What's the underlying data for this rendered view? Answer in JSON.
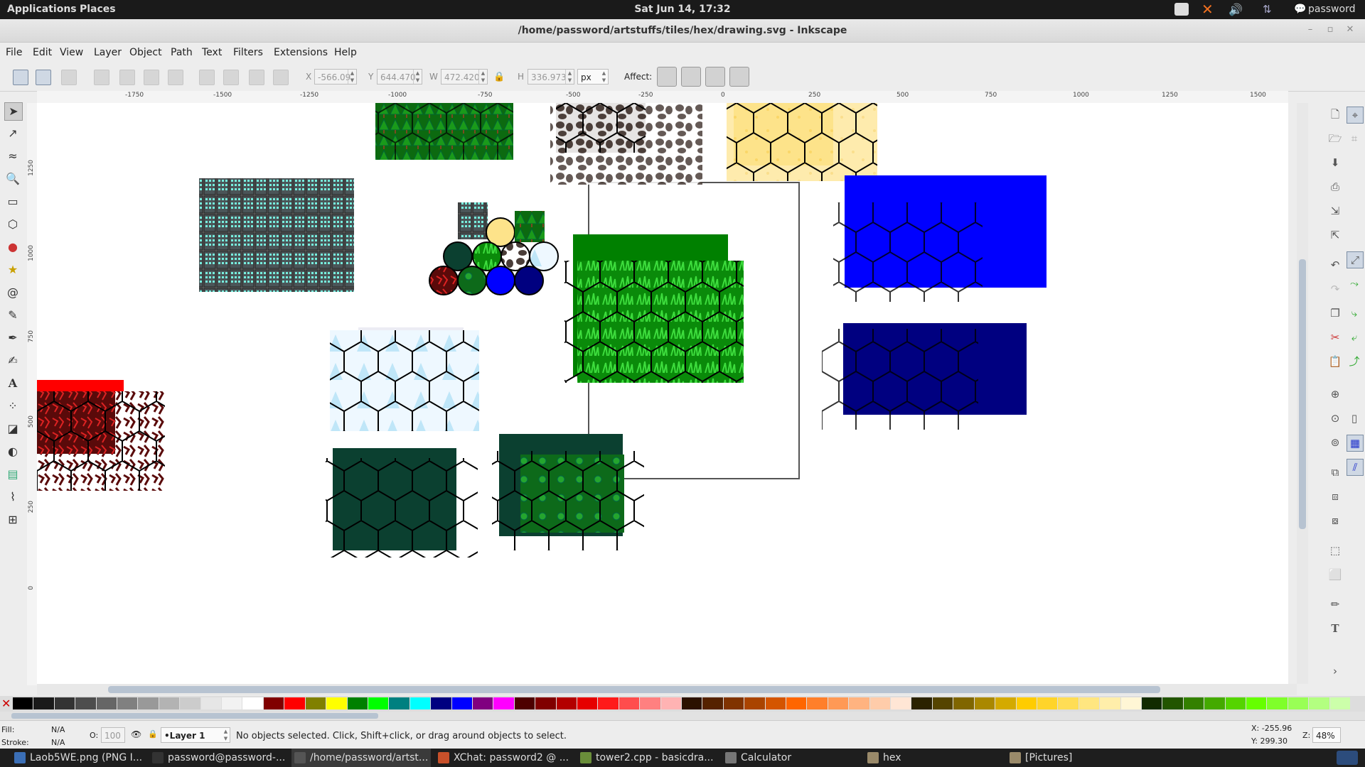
{
  "top_panel": {
    "applications": "Applications",
    "places": "Places",
    "clock": "Sat Jun 14, 17:32",
    "user": "password"
  },
  "window": {
    "title": "/home/password/artstuffs/tiles/hex/drawing.svg - Inkscape"
  },
  "menubar": {
    "items": [
      "File",
      "Edit",
      "View",
      "Layer",
      "Object",
      "Path",
      "Text",
      "Filters",
      "Extensions",
      "Help"
    ]
  },
  "toolbar": {
    "x_label": "X",
    "x_value": "-566.09",
    "y_label": "Y",
    "y_value": "644.470",
    "w_label": "W",
    "w_value": "472.420",
    "h_label": "H",
    "h_value": "336.973",
    "unit": "px",
    "affect_label": "Affect:"
  },
  "ruler": {
    "h_ticks": [
      "-1750",
      "-1500",
      "-1250",
      "-1000",
      "-750",
      "-500",
      "-250",
      "0",
      "250",
      "500",
      "750",
      "1000",
      "1250",
      "1500"
    ],
    "v_ticks": [
      "1250",
      "1000",
      "750",
      "500",
      "250",
      "0"
    ]
  },
  "status": {
    "fill_label": "Fill:",
    "fill_value": "N/A",
    "stroke_label": "Stroke:",
    "stroke_value": "N/A",
    "opacity_label": "O:",
    "opacity_value": "100",
    "layer": "•Layer 1",
    "message": "No objects selected. Click, Shift+click, or drag around objects to select.",
    "x_coord": "X: -255.96",
    "y_coord": "Y: 299.30",
    "zoom_label": "Z:",
    "zoom_value": "48%"
  },
  "taskbar": [
    {
      "label": "Laob5WE.png (PNG I...",
      "color": "#3b6fb6"
    },
    {
      "label": "password@password-...",
      "color": "#333333"
    },
    {
      "label": "/home/password/artst...",
      "color": "#555555"
    },
    {
      "label": "XChat: password2 @ ...",
      "color": "#c8502a"
    },
    {
      "label": "tower2.cpp - basicdra...",
      "color": "#6a8e3a"
    },
    {
      "label": "Calculator",
      "color": "#777777"
    },
    {
      "label": "hex",
      "color": "#9a8a6a"
    },
    {
      "label": "[Pictures]",
      "color": "#9a8a6a"
    }
  ],
  "colors": {
    "panel_bg": "#1a1a1a",
    "canvas_bg": "#ffffff",
    "forest_dark": "#0b4030",
    "grass_green": "#0a8a0a",
    "water_blue": "#0000ff",
    "deep_water": "#000080",
    "lava_red": "#ff0000",
    "sand_yellow": "#fde38a",
    "stone_brown": "#5a4a44"
  }
}
